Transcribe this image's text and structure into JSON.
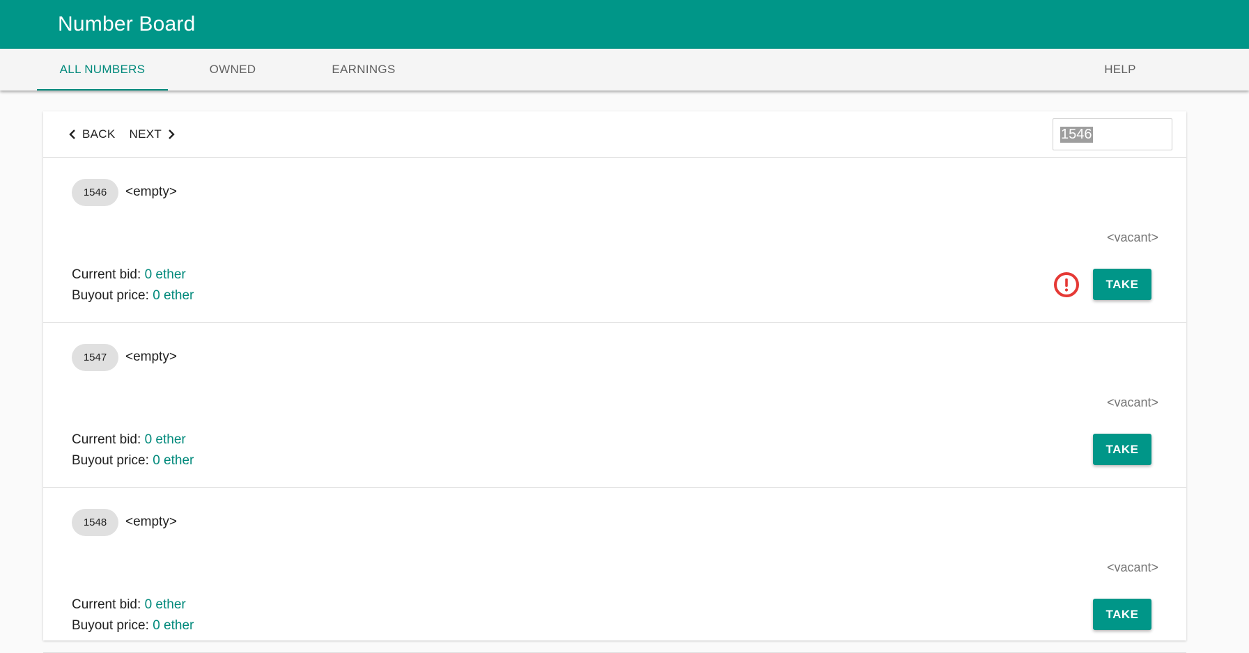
{
  "app": {
    "title": "Number Board"
  },
  "tabs": [
    {
      "label": "ALL NUMBERS",
      "active": true
    },
    {
      "label": "OWNED"
    },
    {
      "label": "EARNINGS"
    },
    {
      "label": "HELP"
    }
  ],
  "pager": {
    "back_label": "BACK",
    "next_label": "NEXT",
    "number_value": "1546"
  },
  "numbers": [
    {
      "number": "1546",
      "content": "<empty>",
      "status": "<vacant>",
      "current_bid_label": "Current bid:",
      "current_bid": "0 ether",
      "buyout_label": "Buyout price:",
      "buyout": "0 ether",
      "action_label": "TAKE",
      "warning": true
    },
    {
      "number": "1547",
      "content": "<empty>",
      "status": "<vacant>",
      "current_bid_label": "Current bid:",
      "current_bid": "0 ether",
      "buyout_label": "Buyout price:",
      "buyout": "0 ether",
      "action_label": "TAKE",
      "warning": false
    },
    {
      "number": "1548",
      "content": "<empty>",
      "status": "<vacant>",
      "current_bid_label": "Current bid:",
      "current_bid": "0 ether",
      "buyout_label": "Buyout price:",
      "buyout": "0 ether",
      "action_label": "TAKE",
      "warning": false
    }
  ],
  "colors": {
    "primary": "#009688",
    "accent_text": "#00897b",
    "warning": "#e53935"
  },
  "icons": {
    "back": "chevron-left-icon",
    "next": "chevron-right-icon",
    "warning": "alert-circle-icon"
  }
}
